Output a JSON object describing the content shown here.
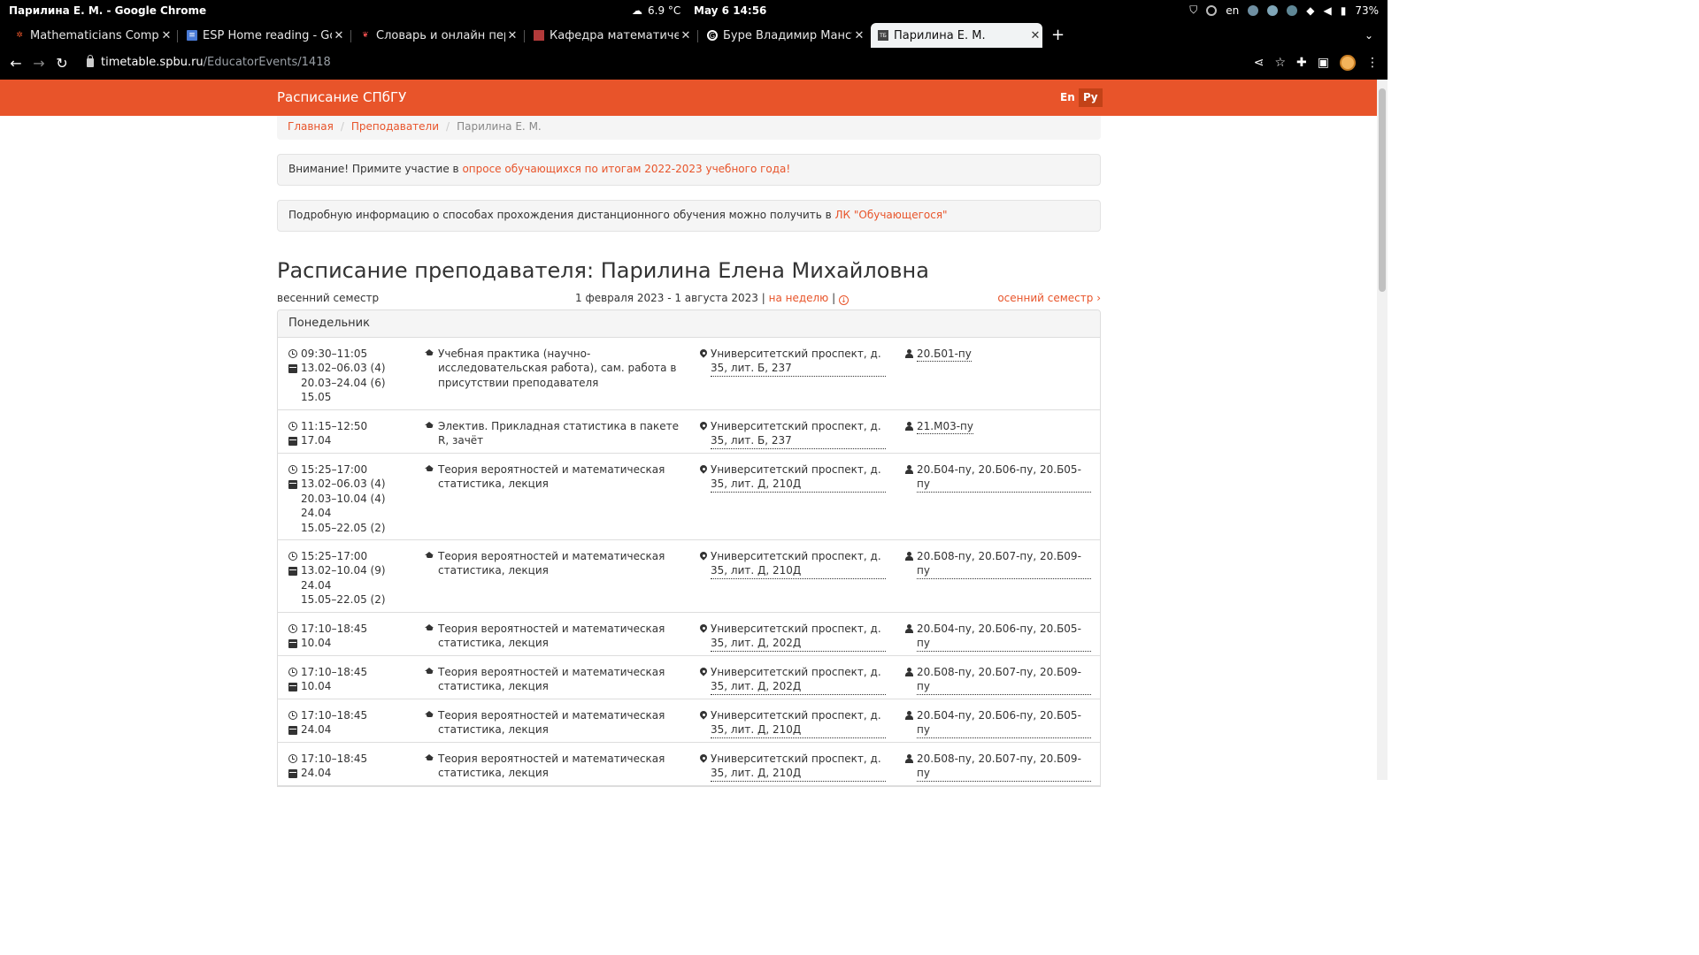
{
  "os": {
    "window_title": "Парилина Е. М. - Google Chrome",
    "weather": "6.9 °C",
    "clock": "May 6  14:56",
    "keyboard_layout": "en",
    "battery": "73%"
  },
  "tabs": [
    {
      "label": "Mathematicians Complet",
      "icon": "sun-favicon"
    },
    {
      "label": "ESP Home reading - Goo",
      "icon": "docs-favicon"
    },
    {
      "label": "Словарь и онлайн пере",
      "icon": "dictionary-favicon"
    },
    {
      "label": "Кафедра математическ",
      "icon": "university-favicon"
    },
    {
      "label": "Буре Владимир Мансур",
      "icon": "google-favicon"
    },
    {
      "label": "Парилина Е. М.",
      "icon": "timetable-favicon",
      "active": true
    }
  ],
  "toolbar": {
    "url_host": "timetable.spbu.ru",
    "url_path": "/EducatorEvents/1418"
  },
  "site": {
    "brand": "Расписание СПбГУ",
    "lang_en": "En",
    "lang_ru": "Ру",
    "accent_color": "#e8542a"
  },
  "breadcrumb": {
    "home": "Главная",
    "teachers": "Преподаватели",
    "current": "Парилина Е. М."
  },
  "notice1": {
    "text": "Внимание! Примите участие в ",
    "link": "опросе обучающихся по итогам 2022-2023 учебного года!"
  },
  "notice2": {
    "text": "Подробную информацию о способах прохождения дистанционного обучения можно получить в ",
    "link": "ЛК \"Обучающегося\""
  },
  "page_title": "Расписание преподавателя: Парилина Елена Михайловна",
  "semester": {
    "current": "весенний семестр",
    "range": "1 февраля 2023 - 1 августа 2023 | ",
    "week_link": "на неделю",
    "separator": " | ",
    "next": "осенний семестр ›"
  },
  "day": {
    "name": "Понедельник",
    "events": [
      {
        "time": "09:30–11:05",
        "dates": [
          "13.02–06.03 (4)",
          "20.03–24.04 (6)",
          "15.05"
        ],
        "subject": "Учебная практика (научно-исследовательская работа), сам. работа в присутствии преподавателя",
        "location": "Университетский проспект, д. 35, лит. Б, 237",
        "groups": "20.Б01-пу"
      },
      {
        "time": "11:15–12:50",
        "dates": [
          "17.04"
        ],
        "subject": "Электив. Прикладная статистика в пакете R, зачёт",
        "location": "Университетский проспект, д. 35, лит. Б, 237",
        "groups": "21.М03-пу"
      },
      {
        "time": "15:25–17:00",
        "dates": [
          "13.02–06.03 (4)",
          "20.03–10.04 (4)",
          "24.04",
          "15.05–22.05 (2)"
        ],
        "subject": "Теория вероятностей и математическая статистика, лекция",
        "location": "Университетский проспект, д. 35, лит. Д, 210Д",
        "groups": "20.Б04-пу, 20.Б06-пу, 20.Б05-пу"
      },
      {
        "time": "15:25–17:00",
        "dates": [
          "13.02–10.04 (9)",
          "24.04",
          "15.05–22.05 (2)"
        ],
        "subject": "Теория вероятностей и математическая статистика, лекция",
        "location": "Университетский проспект, д. 35, лит. Д, 210Д",
        "groups": "20.Б08-пу, 20.Б07-пу, 20.Б09-пу"
      },
      {
        "time": "17:10–18:45",
        "dates": [
          "10.04"
        ],
        "subject": "Теория вероятностей и математическая статистика, лекция",
        "location": "Университетский проспект, д. 35, лит. Д, 202Д",
        "groups": "20.Б04-пу, 20.Б06-пу, 20.Б05-пу"
      },
      {
        "time": "17:10–18:45",
        "dates": [
          "10.04"
        ],
        "subject": "Теория вероятностей и математическая статистика, лекция",
        "location": "Университетский проспект, д. 35, лит. Д, 202Д",
        "groups": "20.Б08-пу, 20.Б07-пу, 20.Б09-пу"
      },
      {
        "time": "17:10–18:45",
        "dates": [
          "24.04"
        ],
        "subject": "Теория вероятностей и математическая статистика, лекция",
        "location": "Университетский проспект, д. 35, лит. Д, 210Д",
        "groups": "20.Б04-пу, 20.Б06-пу, 20.Б05-пу"
      },
      {
        "time": "17:10–18:45",
        "dates": [
          "24.04"
        ],
        "subject": "Теория вероятностей и математическая статистика, лекция",
        "location": "Университетский проспект, д. 35, лит. Д, 210Д",
        "groups": "20.Б08-пу, 20.Б07-пу, 20.Б09-пу"
      }
    ]
  }
}
